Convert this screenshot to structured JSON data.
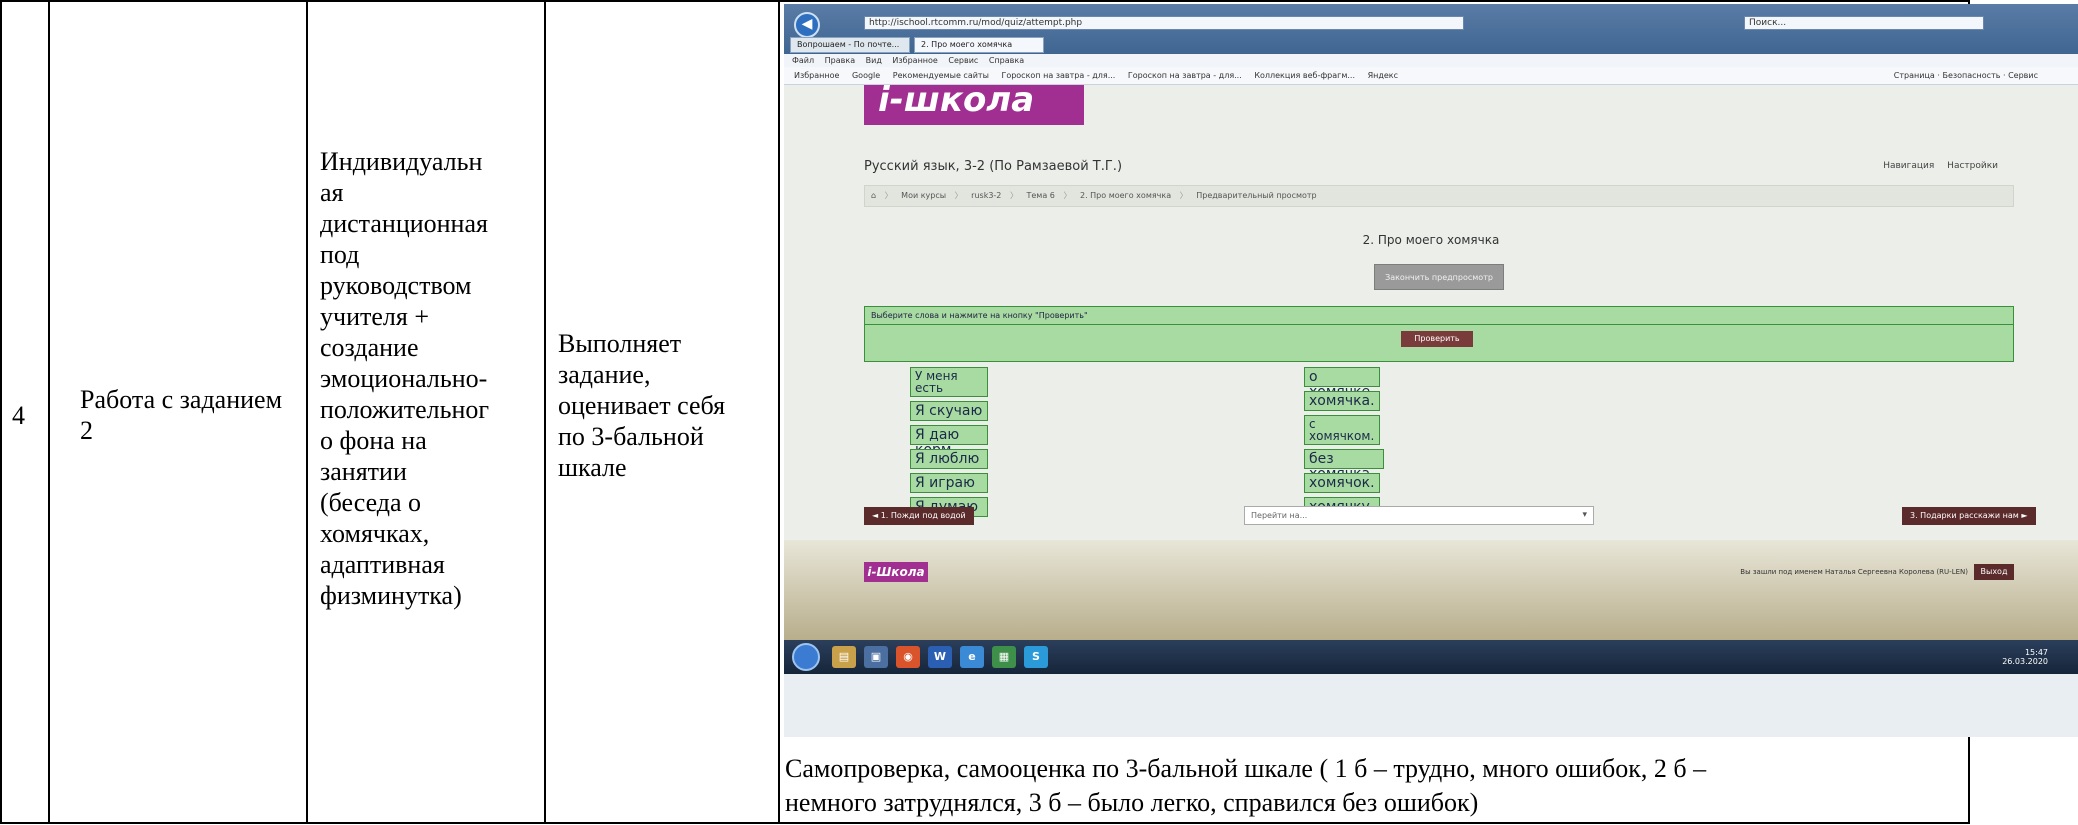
{
  "row": {
    "number": "4",
    "stage": "Работа с заданием 2",
    "form": "Индивидуальная дистанционная под руководством учителя + создание эмоционально-положительного фона на занятии (беседа о хомячках, адаптивная физминутка)",
    "form_lines": [
      "Индивидуальн",
      "ая",
      "дистанционная",
      "под",
      "руководством",
      "учителя +",
      "создание",
      "эмоционально-",
      "положительног",
      "о фона на",
      "занятии",
      "(беседа о",
      "хомячках,",
      "адаптивная",
      "физминутка)"
    ],
    "student_activity_lines": [
      "Выполняет",
      "задание,",
      "оценивает себя",
      "по 3-бальной",
      "шкале"
    ],
    "caption_lines": [
      "Самопроверка, самооценка по 3-бальной шкале ( 1 б – трудно, много ошибок, 2 б –",
      "немного затруднялся, 3 б – было легко, справился без ошибок)"
    ]
  },
  "screenshot": {
    "browser": {
      "url": "http://ischool.rtcomm.ru/mod/quiz/attempt.php",
      "search_placeholder": "Поиск...",
      "tabs": [
        "Вопрошаем - По почте...",
        "2. Про моего хомячка"
      ],
      "menu": [
        "Файл",
        "Правка",
        "Вид",
        "Избранное",
        "Сервис",
        "Справка"
      ],
      "favorites": [
        "Избранное",
        "Google",
        "Рекомендуемые сайты",
        "Гороскоп на завтра - для...",
        "Гороскоп на завтра - для...",
        "Коллекция веб-фрагм...",
        "Яндекс"
      ],
      "tools": [
        "Страница",
        "Безопасность",
        "Сервис"
      ]
    },
    "site": {
      "logo": "i-школа",
      "course_title": "Русский язык, 3-2 (По Рамзаевой Т.Г.)",
      "top_links": [
        "Навигация",
        "Настройки"
      ],
      "breadcrumbs": [
        "Мои курсы",
        "rusk3-2",
        "Тема 6",
        "2. Про моего хомячка",
        "Предварительный просмотр"
      ],
      "activity_title": "2. Про моего хомячка",
      "finish_button": "Закончить предпросмотр",
      "question_text": "Выберите слова и нажмите на кнопку \"Проверить\"",
      "check_button": "Проверить",
      "left_options": [
        "У меня есть",
        "Я скучаю",
        "Я даю корм",
        "Я люблю",
        "Я играю",
        "Я думаю"
      ],
      "right_options": [
        "о хомячке.",
        "хомячка.",
        "с хомячком.",
        "без хомячка.",
        "хомячок.",
        "хомячку."
      ],
      "prev_button": "◄ 1. Пожди под водой",
      "jump_placeholder": "Перейти на...",
      "next_button": "3. Подарки расскажи нам ►",
      "footer_logo": "i-Школа",
      "footer_login": "Вы зашли под именем Наталья Сергеевна Королева (RU-LEN)",
      "footer_exit": "Выход"
    },
    "taskbar": {
      "clock_time": "15:47",
      "clock_date": "26.03.2020"
    }
  }
}
